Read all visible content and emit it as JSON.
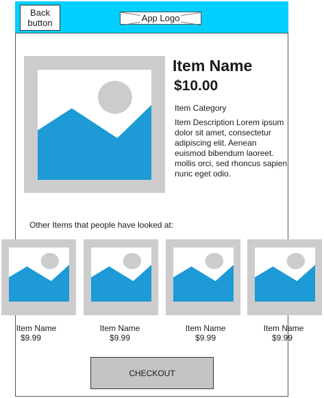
{
  "header": {
    "back_label": "Back button",
    "logo_label": "App Logo"
  },
  "product": {
    "name": "Item Name",
    "price": "$10.00",
    "category": "Item Category",
    "description": "Item Description Lorem ipsum dolor sit amet, consectetur adipiscing elit. Aenean euismod bibendum laoreet.  mollis orci, sed rhoncus sapien nunc eget odio."
  },
  "related": {
    "label": "Other Items that people have looked at:",
    "items": [
      {
        "name": "Item Name",
        "price": "$9.99"
      },
      {
        "name": "Item Name",
        "price": "$9.99"
      },
      {
        "name": "Item Name",
        "price": "$9.99"
      },
      {
        "name": "Item Name",
        "price": "$9.99"
      }
    ]
  },
  "checkout_label": "CHECKOUT",
  "colors": {
    "header": "#00cfff",
    "placeholder_bg": "#cccccc",
    "mountain": "#1e9ad6",
    "sun": "#cccccc",
    "button": "#c4c4c4"
  },
  "icons": {
    "image_placeholder": "image-placeholder-icon"
  }
}
